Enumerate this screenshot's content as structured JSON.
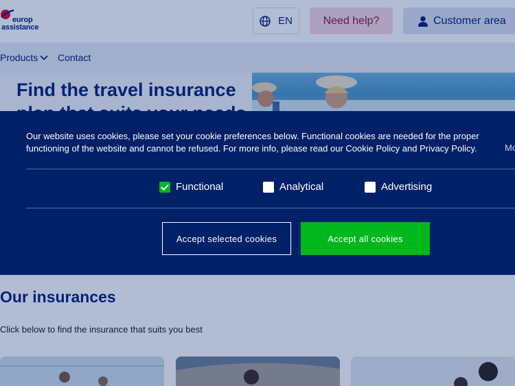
{
  "brand": {
    "logo_text": "europ assistance"
  },
  "header": {
    "language": "EN",
    "help_label": "Need help?",
    "customer_label": "Customer area"
  },
  "nav": {
    "items": [
      {
        "label": "Products"
      },
      {
        "label": "Contact"
      }
    ]
  },
  "hero": {
    "title": "Find the travel insurance plan that suits your needs"
  },
  "cookie_banner": {
    "message": "Our website uses cookies, please set your cookie preferences below. Functional cookies are needed for the proper functioning of the website and cannot be refused. For more info, please read our Cookie Policy and Privacy Policy.",
    "more_link": "Mo",
    "options": [
      {
        "label": "Functional",
        "checked": true
      },
      {
        "label": "Analytical",
        "checked": false
      },
      {
        "label": "Advertising",
        "checked": false
      }
    ],
    "accept_selected_label": "Accept selected cookies",
    "accept_all_label": "Accept all cookies"
  },
  "insurances": {
    "title": "Our insurances",
    "subtitle": "Click below to find the insurance that suits you best"
  },
  "colors": {
    "brand_blue": "#00247d",
    "banner_bg": "#002068",
    "accept_green": "#00b81d",
    "help_bg": "#f8d8e2"
  }
}
